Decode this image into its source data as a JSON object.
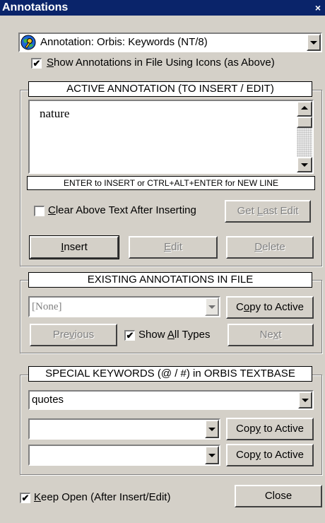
{
  "window": {
    "title": "Annotations",
    "close_glyph": "×"
  },
  "annotation_type": {
    "selected": "Annotation: Orbis: Keywords (NT/8)",
    "icon": "orbis-globe-key-icon"
  },
  "show_icons": {
    "checked": true,
    "label_pre": "",
    "label_u": "S",
    "label_post": "how Annotations in File Using Icons (as Above)"
  },
  "active": {
    "title": "ACTIVE ANNOTATION (TO INSERT / EDIT)",
    "text": "nature",
    "hint": "ENTER to INSERT  or  CTRL+ALT+ENTER for NEW LINE",
    "clear_checkbox": {
      "checked": false,
      "label_pre": "",
      "label_u": "C",
      "label_post": "lear Above Text After Inserting"
    },
    "get_last_edit": {
      "pre": "Get ",
      "u": "L",
      "post": "ast Edit"
    },
    "insert": {
      "pre": "",
      "u": "I",
      "post": "nsert"
    },
    "edit": {
      "pre": "",
      "u": "E",
      "post": "dit"
    },
    "delete": {
      "pre": "",
      "u": "D",
      "post": "elete"
    }
  },
  "existing": {
    "title": "EXISTING ANNOTATIONS IN FILE",
    "combo_value": "[None]",
    "copy": {
      "pre": "C",
      "u": "o",
      "post": "py to Active"
    },
    "previous": {
      "pre": "Pre",
      "u": "v",
      "post": "ious"
    },
    "show_all": {
      "checked": true,
      "label_pre": "Show ",
      "label_u": "A",
      "label_post": "ll Types"
    },
    "next": {
      "pre": "Ne",
      "u": "x",
      "post": "t"
    }
  },
  "special": {
    "title": "SPECIAL KEYWORDS (@ / #) in ORBIS TEXTBASE",
    "combo_main": "quotes",
    "combo_a": "",
    "combo_b": "",
    "copy_a": {
      "pre": "Cop",
      "u": "y",
      "post": " to Active"
    },
    "copy_b": {
      "pre": "Cop",
      "u": "y",
      "post": " to Active"
    }
  },
  "footer": {
    "keep_open": {
      "checked": true,
      "label_pre": "",
      "label_u": "K",
      "label_post": "eep Open (After Insert/Edit)"
    },
    "close": "Close"
  },
  "check_glyph": "✔"
}
